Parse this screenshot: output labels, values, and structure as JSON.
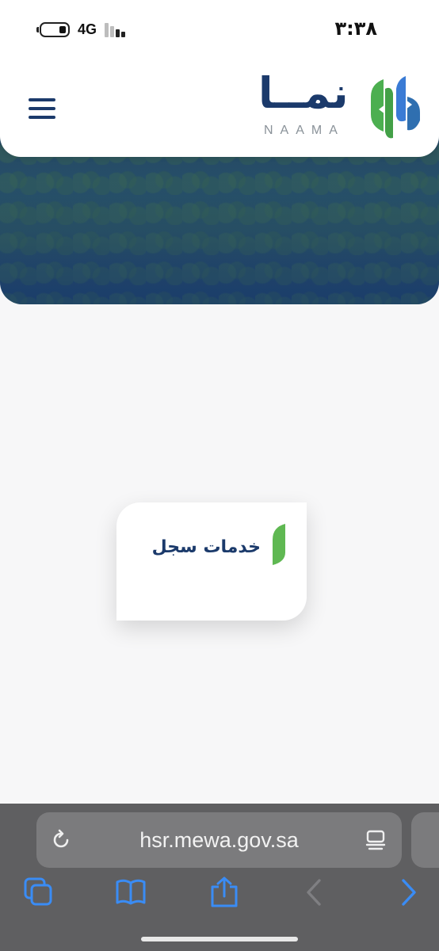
{
  "status_bar": {
    "time": "٣:٣٨",
    "network": "4G"
  },
  "header": {
    "logo_arabic": "نمــا",
    "logo_latin": "NAAMA",
    "brand_colors": {
      "green": "#4caf50",
      "blue": "#3a7bd5",
      "navy": "#1b3a6b",
      "grey": "#8a9299"
    }
  },
  "service_card": {
    "title": "خدمات سجل",
    "accent": "#5fb852"
  },
  "browser": {
    "url": "hsr.mewa.gov.sa",
    "toolbar": [
      "tabs-icon",
      "bookmarks-icon",
      "share-icon",
      "back-icon",
      "forward-icon"
    ]
  }
}
